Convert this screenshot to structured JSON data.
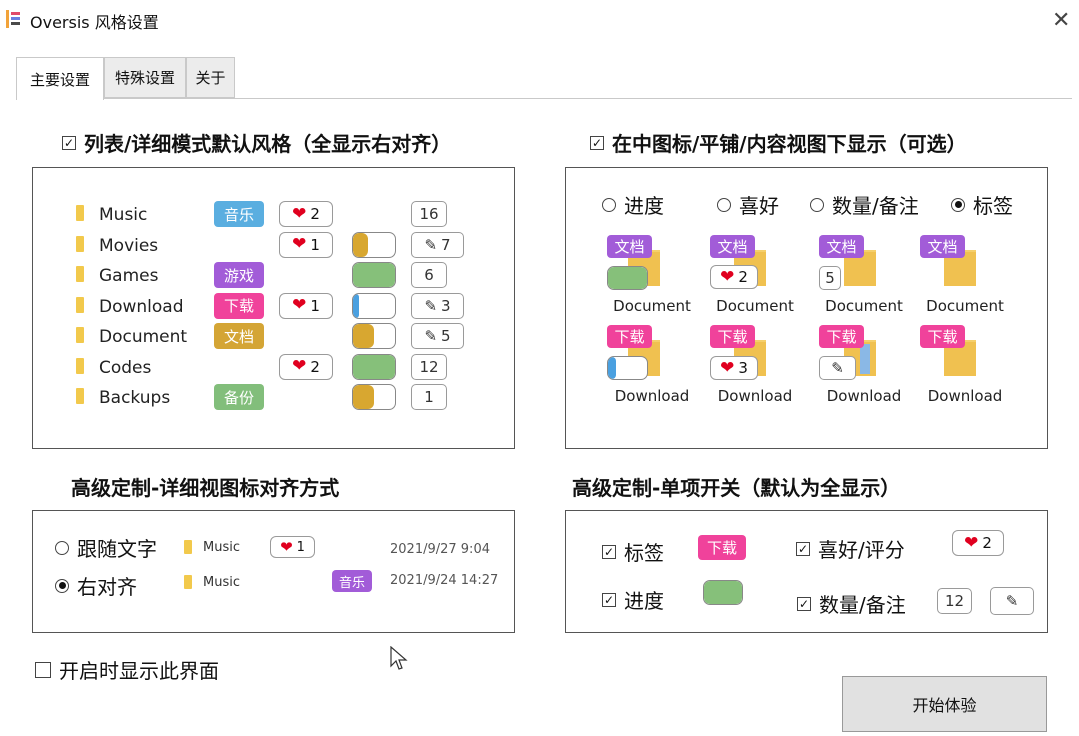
{
  "window": {
    "title": "Oversis 风格设置",
    "close": "✕"
  },
  "tabs": [
    {
      "label": "主要设置"
    },
    {
      "label": "特殊设置"
    },
    {
      "label": "关于"
    }
  ],
  "colors": {
    "blue_tag": "#5aaee0",
    "purple_tag": "#a25cd8",
    "pink_tag": "#f0429b",
    "gold_tag": "#d4a535",
    "green_tag": "#82be7b",
    "progress_green": "#86c07a",
    "progress_gold": "#d8a730",
    "progress_blue": "#4aa0e0"
  },
  "section1": {
    "title": "列表/详细模式默认风格（全显示右对齐）",
    "checked": true,
    "rows": [
      {
        "name": "Music",
        "tag": "音乐",
        "tag_color": "blue",
        "likes": "2",
        "progress_color": "",
        "progress": null,
        "note": false,
        "count": "16"
      },
      {
        "name": "Movies",
        "tag": "",
        "tag_color": "",
        "likes": "1",
        "progress_color": "gold",
        "progress": 0.35,
        "note": true,
        "count": "7"
      },
      {
        "name": "Games",
        "tag": "游戏",
        "tag_color": "purple",
        "likes": "",
        "progress_color": "green",
        "progress": 1.0,
        "note": false,
        "count": "6"
      },
      {
        "name": "Download",
        "tag": "下载",
        "tag_color": "pink",
        "likes": "1",
        "progress_color": "blue",
        "progress": 0.15,
        "note": true,
        "count": "3"
      },
      {
        "name": "Document",
        "tag": "文档",
        "tag_color": "gold",
        "likes": "",
        "progress_color": "gold",
        "progress": 0.5,
        "note": true,
        "count": "5"
      },
      {
        "name": "Codes",
        "tag": "",
        "tag_color": "",
        "likes": "2",
        "progress_color": "green",
        "progress": 1.0,
        "note": false,
        "count": "12"
      },
      {
        "name": "Backups",
        "tag": "备份",
        "tag_color": "green",
        "likes": "",
        "progress_color": "gold",
        "progress": 0.5,
        "note": false,
        "count": "1"
      }
    ]
  },
  "section2": {
    "title": "在中图标/平铺/内容视图下显示（可选）",
    "checked": true,
    "options": [
      {
        "label": "进度",
        "selected": false
      },
      {
        "label": "喜好",
        "selected": false
      },
      {
        "label": "数量/备注",
        "selected": false
      },
      {
        "label": "标签",
        "selected": true
      }
    ],
    "row1": {
      "tag": "文档",
      "label": "Document",
      "likes": "2",
      "count": "5"
    },
    "row2": {
      "tag": "下载",
      "label": "Download",
      "likes": "3"
    }
  },
  "section3": {
    "title": "高级定制-详细视图标对齐方式",
    "options": [
      {
        "label": "跟随文字",
        "selected": false
      },
      {
        "label": "右对齐",
        "selected": true
      }
    ],
    "name": "Music",
    "likes": "1",
    "tag": "音乐",
    "date1": "2021/9/27 9:04",
    "date2": "2021/9/24 14:27"
  },
  "section4": {
    "title": "高级定制-单项开关（默认为全显示）",
    "items": [
      {
        "label": "标签",
        "checked": true
      },
      {
        "label": "喜好/评分",
        "checked": true
      },
      {
        "label": "进度",
        "checked": true
      },
      {
        "label": "数量/备注",
        "checked": true
      }
    ],
    "tag": "下载",
    "likes": "2",
    "count": "12"
  },
  "show_on_start": {
    "label": "开启时显示此界面",
    "checked": false
  },
  "start_button": "开始体验"
}
